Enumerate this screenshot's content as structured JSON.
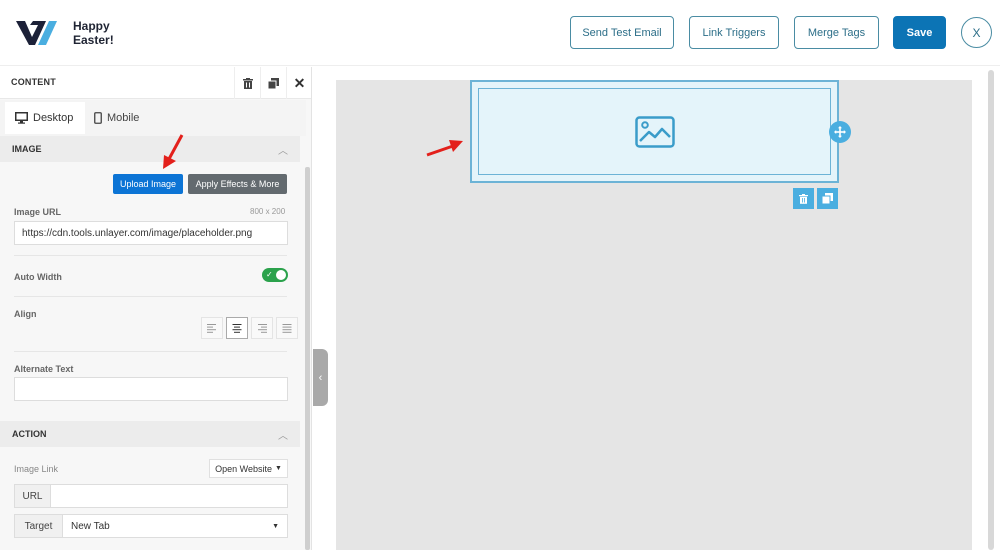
{
  "app": {
    "title": "Happy Easter!",
    "logo": "brand-logo"
  },
  "toolbar": {
    "send_test_email": "Send Test Email",
    "link_triggers": "Link Triggers",
    "merge_tags": "Merge Tags",
    "save": "Save",
    "close": "X"
  },
  "panel": {
    "title": "CONTENT",
    "header_icons": [
      "trash-icon",
      "duplicate-icon",
      "close-icon"
    ],
    "tabs": [
      {
        "label": "Desktop",
        "icon": "desktop-icon",
        "active": true
      },
      {
        "label": "Mobile",
        "icon": "mobile-icon",
        "active": false
      }
    ],
    "image_section": {
      "label": "IMAGE",
      "upload_button": "Upload Image",
      "effects_button": "Apply Effects & More",
      "image_url_label": "Image URL",
      "image_size": "800 x 200",
      "image_url_value": "https://cdn.tools.unlayer.com/image/placeholder.png",
      "auto_width_label": "Auto Width",
      "auto_width_on": true,
      "align_label": "Align",
      "align_options": [
        "left",
        "center",
        "right",
        "justify"
      ],
      "align_selected": "center",
      "alt_text_label": "Alternate Text",
      "alt_text_value": ""
    },
    "action_section": {
      "label": "ACTION",
      "image_link_label": "Image Link",
      "image_link_type": "Open Website",
      "url_addon": "URL",
      "url_value": "",
      "target_addon": "Target",
      "target_value": "New Tab"
    }
  },
  "canvas": {
    "block_type": "image-placeholder",
    "colors": {
      "accent": "#4aaee0",
      "primary_button": "#0c74b5",
      "toggle_on": "#2ba24c"
    }
  }
}
